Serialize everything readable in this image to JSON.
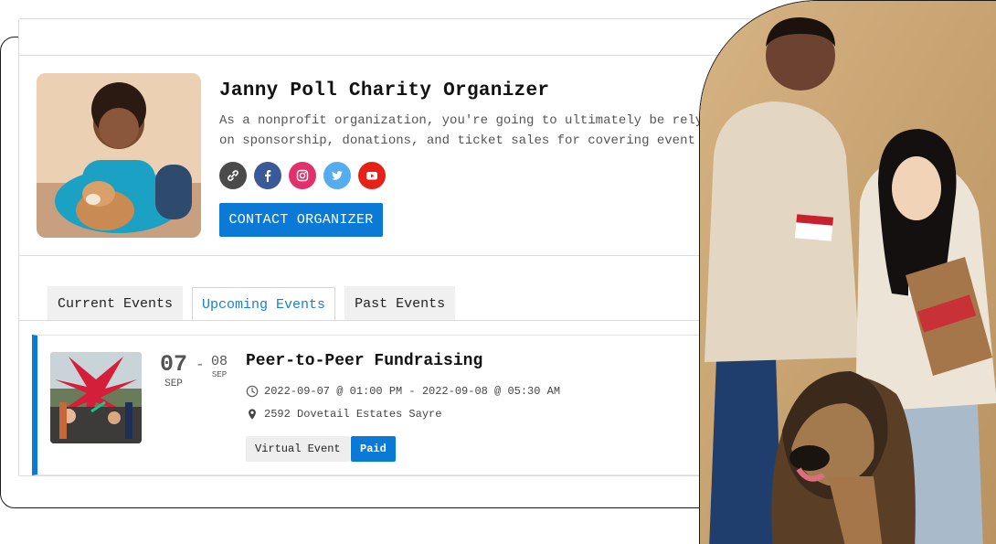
{
  "organizer": {
    "name": "Janny Poll Charity Organizer",
    "description_line1": "As a nonprofit organization, you're going to ultimately be relying",
    "description_line2": "on sponsorship, donations, and ticket sales for covering event cos",
    "socials": [
      {
        "name": "website",
        "icon": "link-icon",
        "color": "#4a4a4a"
      },
      {
        "name": "facebook",
        "icon": "facebook-icon",
        "color": "#3b5998"
      },
      {
        "name": "instagram",
        "icon": "instagram-icon",
        "color": "#e1306c"
      },
      {
        "name": "twitter",
        "icon": "twitter-icon",
        "color": "#55acee"
      },
      {
        "name": "youtube",
        "icon": "youtube-icon",
        "color": "#e62117"
      }
    ],
    "contact_label": "CONTACT ORGANIZER"
  },
  "tabs": [
    {
      "label": "Current Events",
      "active": false
    },
    {
      "label": "Upcoming Events",
      "active": true
    },
    {
      "label": "Past Events",
      "active": false
    }
  ],
  "event": {
    "start_day": "07",
    "start_month": "SEP",
    "separator": "-",
    "end_day": "08",
    "end_month": "SEP",
    "title": "Peer-to-Peer Fundraising",
    "datetime": "2022-09-07 @ 01:00 PM - 2022-09-08 @ 05:30 AM",
    "location": "2592 Dovetail Estates Sayre",
    "tags": [
      "Virtual Event",
      "Paid"
    ]
  },
  "colors": {
    "accent": "#0a7ad6",
    "tab_active_text": "#1a7fd0"
  }
}
